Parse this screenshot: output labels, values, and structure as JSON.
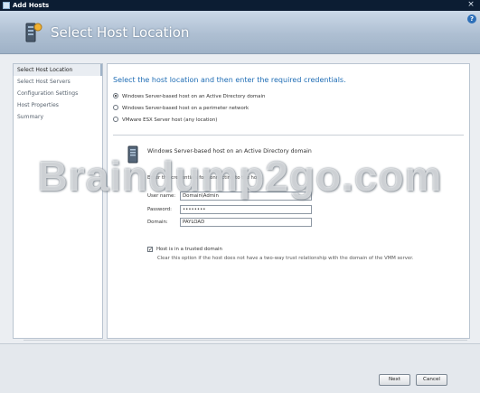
{
  "window": {
    "title": "Add Hosts",
    "close_glyph": "×"
  },
  "header": {
    "title": "Select Host Location",
    "help_glyph": "?"
  },
  "sidebar": {
    "items": [
      {
        "label": "Select Host Location"
      },
      {
        "label": "Select Host Servers"
      },
      {
        "label": "Configuration Settings"
      },
      {
        "label": "Host Properties"
      },
      {
        "label": "Summary"
      }
    ]
  },
  "main": {
    "heading": "Select the host location and then enter the required credentials.",
    "options": [
      {
        "label": "Windows Server-based host on an Active Directory domain",
        "checked": true
      },
      {
        "label": "Windows Server-based host on a perimeter network",
        "checked": false
      },
      {
        "label": "VMware ESX Server host (any location)",
        "checked": false
      }
    ],
    "section_title": "Windows Server-based host on an Active Directory domain",
    "instruction": "Enter the credentials for connecting to the host.",
    "fields": {
      "user_label": "User name:",
      "user_value": "Domain\\Admin",
      "password_label": "Password:",
      "password_value": "••••••••",
      "domain_label": "Domain:",
      "domain_value": "PAYLOAD"
    },
    "trusted_checkbox_label": "Host is in a trusted domain",
    "trusted_checked": true,
    "trusted_note": "Clear this option if the host does not have a two-way trust relationship with the domain of the VMM server."
  },
  "footer": {
    "next_label": "Next",
    "cancel_label": "Cancel"
  },
  "watermark": "Braindump2go.com",
  "icons": {
    "title": "app-icon",
    "header": "server-wizard-icon",
    "section": "server-icon",
    "help": "help-icon",
    "close": "close-icon"
  }
}
